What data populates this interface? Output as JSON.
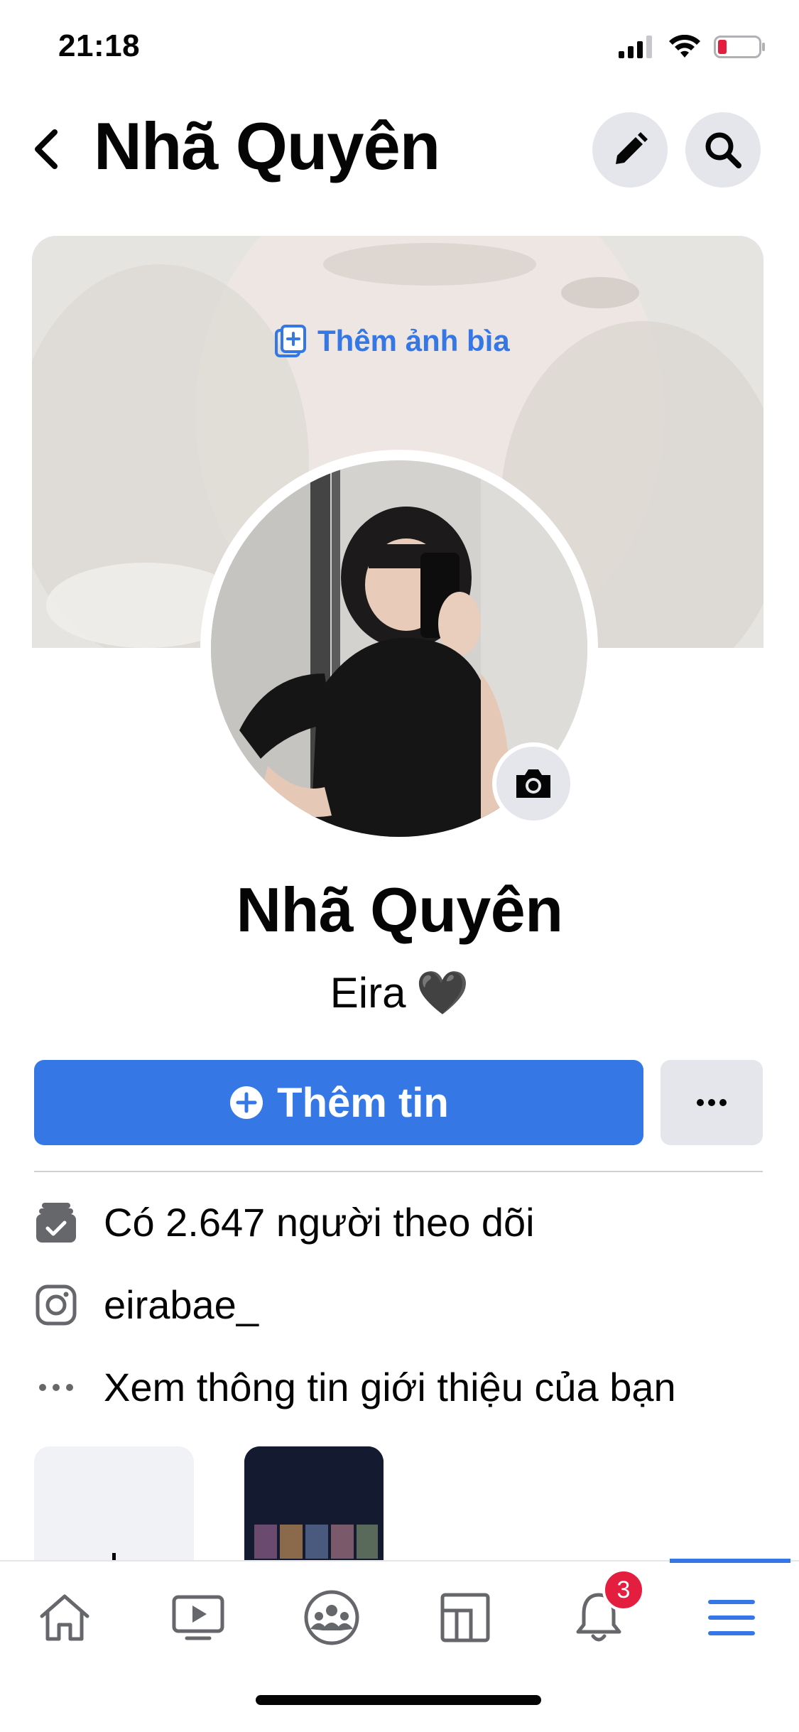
{
  "status_bar": {
    "time": "21:18",
    "battery_color": "#e41e3f"
  },
  "header": {
    "title": "Nhã Quyên",
    "back_icon": "chevron-left-icon",
    "edit_icon": "pencil-icon",
    "search_icon": "search-icon"
  },
  "cover": {
    "add_cover_label": "Thêm ảnh bìa"
  },
  "profile": {
    "name": "Nhã Quyên",
    "bio": "Eira",
    "bio_emoji": "🖤"
  },
  "actions": {
    "add_story_label": "Thêm tin",
    "more_label": "•••"
  },
  "info": [
    {
      "icon": "followers-icon",
      "text": "Có 2.647 người theo dõi"
    },
    {
      "icon": "instagram-icon",
      "text": "eirabae_"
    },
    {
      "icon": "more-dots-icon",
      "text": "Xem thông tin giới thiệu của bạn"
    }
  ],
  "tabbar": {
    "tabs": [
      "home",
      "watch",
      "groups",
      "pages",
      "notifications",
      "menu"
    ],
    "active": "menu",
    "notification_badge": "3",
    "accent_color": "#3578e5"
  }
}
